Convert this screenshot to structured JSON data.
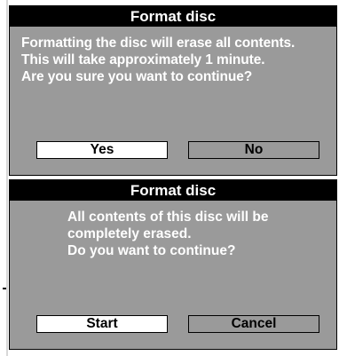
{
  "dialogs": [
    {
      "title": "Format disc",
      "message_lines": [
        "Formatting the disc will erase all contents.",
        "This will take approximately 1 minute.",
        "Are you sure you want to continue?"
      ],
      "buttons": [
        {
          "label": "Yes",
          "selected": true
        },
        {
          "label": "No",
          "selected": false
        }
      ]
    },
    {
      "title": "Format disc",
      "message_lines": [
        "All contents of this disc will be",
        "completely erased.",
        "Do you want to continue?"
      ],
      "buttons": [
        {
          "label": "Start",
          "selected": true
        },
        {
          "label": "Cancel",
          "selected": false
        }
      ]
    }
  ],
  "colors": {
    "dialog_background": "#9a9a9a",
    "title_bar": "#000000",
    "title_text": "#ffffff",
    "message_text": "#ffffff",
    "selected_button": "#ffffff",
    "unselected_button": "#9a9a9a"
  }
}
